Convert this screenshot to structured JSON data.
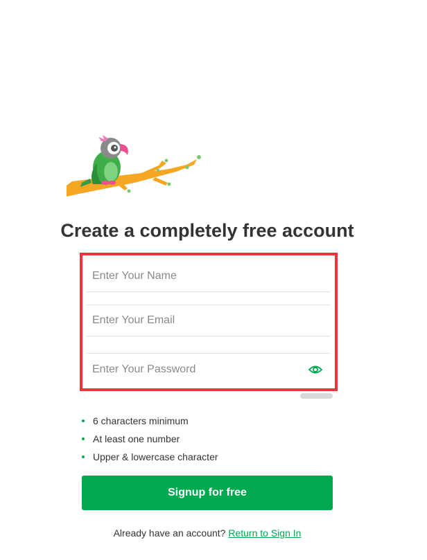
{
  "brand": {
    "logo_icon": "parrot-on-branch-icon",
    "colors": {
      "accent_green": "#00a84f",
      "highlight_red": "#e8383d",
      "branch_orange": "#f5a623"
    }
  },
  "header": {
    "title": "Create a completely free account"
  },
  "form": {
    "name_placeholder": "Enter Your Name",
    "email_placeholder": "Enter Your Email",
    "password_placeholder": "Enter Your Password",
    "password_toggle_icon": "eye-icon"
  },
  "password_rules": [
    "6 characters minimum",
    "At least one number",
    "Upper & lowercase character"
  ],
  "signup_button": {
    "label": "Signup for free"
  },
  "signin": {
    "prompt": "Already have an account?",
    "link_label": "Return to Sign In"
  }
}
